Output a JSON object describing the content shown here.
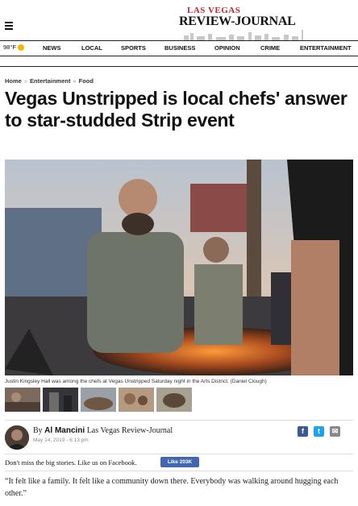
{
  "header": {
    "logo_top": "LAS VEGAS",
    "logo_bottom": "REVIEW-JOURNAL",
    "weather": "98°F"
  },
  "nav": [
    "NEWS",
    "LOCAL",
    "SPORTS",
    "BUSINESS",
    "OPINION",
    "CRIME",
    "ENTERTAINMENT"
  ],
  "breadcrumb": [
    "Home",
    "Entertainment",
    "Food"
  ],
  "article": {
    "headline": "Vegas Unstripped is local chefs' answer to star-studded Strip event",
    "caption": "Justin Kingsley Hall was among the chefs at Vegas Unstripped Saturday night in the Arts District. (Daniel Clough)",
    "byline_prefix": "By",
    "author": "Al Mancini",
    "publication": "Las Vegas Review-Journal",
    "date": "May 14, 2019 - 6:13 pm",
    "share_icons": [
      "facebook-icon",
      "twitter-icon",
      "email-icon"
    ]
  },
  "facebook": {
    "prompt": "Don't miss the big stories. Like us on Facebook.",
    "like_label": "Like 203K"
  },
  "quote": "“It felt like a family. It felt like a community down there. Everybody was walking around hugging each other.”",
  "colors": {
    "brand_red": "#c1272d",
    "facebook_blue": "#3b5998",
    "twitter_blue": "#1da1f2"
  }
}
